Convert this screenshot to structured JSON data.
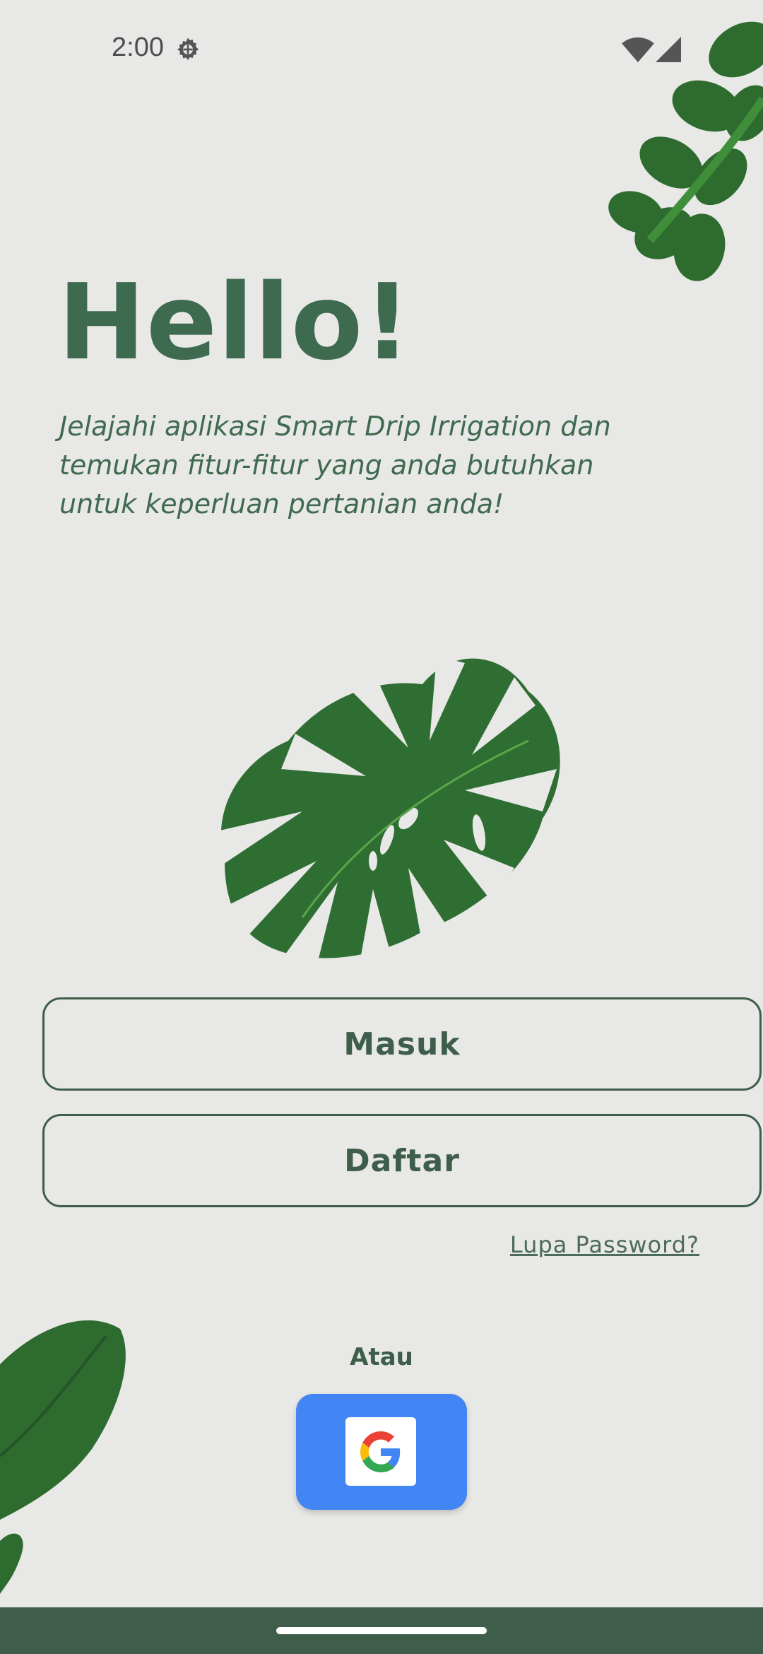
{
  "status_bar": {
    "time": "2:00",
    "icons": [
      "gear-icon",
      "wifi-icon",
      "cellular-signal-icon"
    ],
    "icon_color": "#555555"
  },
  "welcome": {
    "title": "Hello!",
    "description": "Jelajahi aplikasi Smart Drip Irrigation dan temukan fitur-fitur yang anda butuhkan untuk keperluan pertanian anda!"
  },
  "illustrations": [
    "leaves-illustration",
    "monstera-leaf-illustration",
    "banana-leaf-illustration"
  ],
  "actions": {
    "login_label": "Masuk",
    "register_label": "Daftar",
    "forgot_password": "Lupa Password?",
    "or_label": "Atau",
    "google_icon": "google-icon"
  },
  "colors": {
    "background": "#e8e8e6",
    "primary_green": "#3e5e4b",
    "title_green": "#3e6b4f",
    "leaf_green": "#2e6b2f",
    "google_blue": "#4285f4"
  }
}
